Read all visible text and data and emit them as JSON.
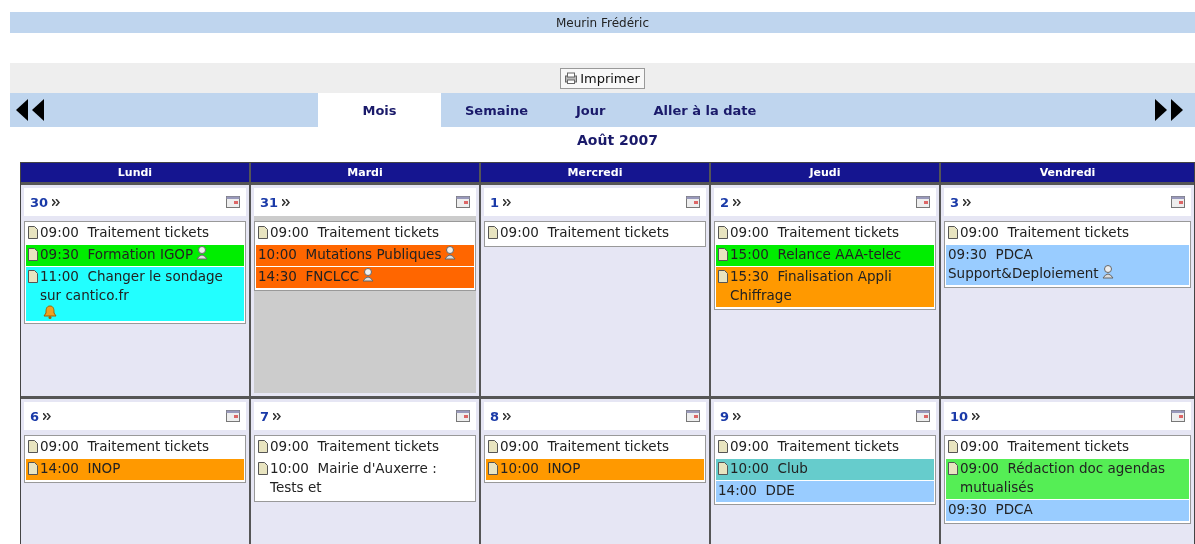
{
  "header": {
    "title": "Meurin Frédéric"
  },
  "toolbar": {
    "print_button": "Imprimer"
  },
  "nav": {
    "tabs": [
      {
        "label": "Mois",
        "selected": true
      },
      {
        "label": "Semaine",
        "selected": false
      },
      {
        "label": "Jour",
        "selected": false
      },
      {
        "label": "Aller à la date",
        "selected": false
      }
    ]
  },
  "month_title": "Août 2007",
  "weekdays": [
    "Lundi",
    "Mardi",
    "Mercredi",
    "Jeudi",
    "Vendredi"
  ],
  "weeks": [
    [
      {
        "day": "30",
        "shaded": false,
        "events": [
          {
            "time": "09:00",
            "title": "Traitement tickets",
            "color": "#ffffff",
            "note": true,
            "attendees": false,
            "reminder": false
          },
          {
            "time": "09:30",
            "title": "Formation IGOP",
            "color": "#00ee00",
            "note": true,
            "attendees": true,
            "reminder": false
          },
          {
            "time": "11:00",
            "title": "Changer le sondage sur cantico.fr",
            "color": "#22ffff",
            "note": true,
            "attendees": false,
            "reminder": true
          }
        ]
      },
      {
        "day": "31",
        "shaded": true,
        "events": [
          {
            "time": "09:00",
            "title": "Traitement tickets",
            "color": "#ffffff",
            "note": true,
            "attendees": false,
            "reminder": false
          },
          {
            "time": "10:00",
            "title": "Mutations Publiques",
            "color": "#ff6600",
            "note": false,
            "attendees": true,
            "reminder": false
          },
          {
            "time": "14:30",
            "title": "FNCLCC",
            "color": "#ff6600",
            "note": false,
            "attendees": true,
            "reminder": false
          }
        ]
      },
      {
        "day": "1",
        "shaded": false,
        "events": [
          {
            "time": "09:00",
            "title": "Traitement tickets",
            "color": "#ffffff",
            "note": true,
            "attendees": false,
            "reminder": false
          }
        ]
      },
      {
        "day": "2",
        "shaded": false,
        "events": [
          {
            "time": "09:00",
            "title": "Traitement tickets",
            "color": "#ffffff",
            "note": true,
            "attendees": false,
            "reminder": false
          },
          {
            "time": "15:00",
            "title": "Relance AAA-telec",
            "color": "#00ee00",
            "note": true,
            "attendees": false,
            "reminder": false
          },
          {
            "time": "15:30",
            "title": "Finalisation Appli Chiffrage",
            "color": "#ff9900",
            "note": true,
            "attendees": false,
            "reminder": false
          }
        ]
      },
      {
        "day": "3",
        "shaded": false,
        "events": [
          {
            "time": "09:00",
            "title": "Traitement tickets",
            "color": "#ffffff",
            "note": true,
            "attendees": false,
            "reminder": false
          },
          {
            "time": "09:30",
            "title": "PDCA Support&Deploiement",
            "color": "#99ccff",
            "note": false,
            "attendees": true,
            "reminder": false
          }
        ]
      }
    ],
    [
      {
        "day": "6",
        "shaded": false,
        "events": [
          {
            "time": "09:00",
            "title": "Traitement tickets",
            "color": "#ffffff",
            "note": true,
            "attendees": false,
            "reminder": false
          },
          {
            "time": "14:00",
            "title": "INOP",
            "color": "#ff9900",
            "note": true,
            "attendees": false,
            "reminder": false
          }
        ]
      },
      {
        "day": "7",
        "shaded": false,
        "events": [
          {
            "time": "09:00",
            "title": "Traitement tickets",
            "color": "#ffffff",
            "note": true,
            "attendees": false,
            "reminder": false
          },
          {
            "time": "10:00",
            "title": "Mairie d'Auxerre : Tests et",
            "color": "#ffffff",
            "note": true,
            "attendees": false,
            "reminder": false
          }
        ]
      },
      {
        "day": "8",
        "shaded": false,
        "events": [
          {
            "time": "09:00",
            "title": "Traitement tickets",
            "color": "#ffffff",
            "note": true,
            "attendees": false,
            "reminder": false
          },
          {
            "time": "10:00",
            "title": "INOP",
            "color": "#ff9900",
            "note": true,
            "attendees": false,
            "reminder": false
          }
        ]
      },
      {
        "day": "9",
        "shaded": false,
        "events": [
          {
            "time": "09:00",
            "title": "Traitement tickets",
            "color": "#ffffff",
            "note": true,
            "attendees": false,
            "reminder": false
          },
          {
            "time": "10:00",
            "title": "Club",
            "color": "#66cccc",
            "note": true,
            "attendees": false,
            "reminder": false
          },
          {
            "time": "14:00",
            "title": "DDE",
            "color": "#99ccff",
            "note": false,
            "attendees": false,
            "reminder": false
          }
        ]
      },
      {
        "day": "10",
        "shaded": false,
        "events": [
          {
            "time": "09:00",
            "title": "Traitement tickets",
            "color": "#ffffff",
            "note": true,
            "attendees": false,
            "reminder": false
          },
          {
            "time": "09:00",
            "title": "Rédaction doc agendas mutualisés",
            "color": "#55ee55",
            "note": true,
            "attendees": false,
            "reminder": false
          },
          {
            "time": "09:30",
            "title": "PDCA",
            "color": "#99ccff",
            "note": false,
            "attendees": false,
            "reminder": false
          }
        ]
      }
    ]
  ]
}
